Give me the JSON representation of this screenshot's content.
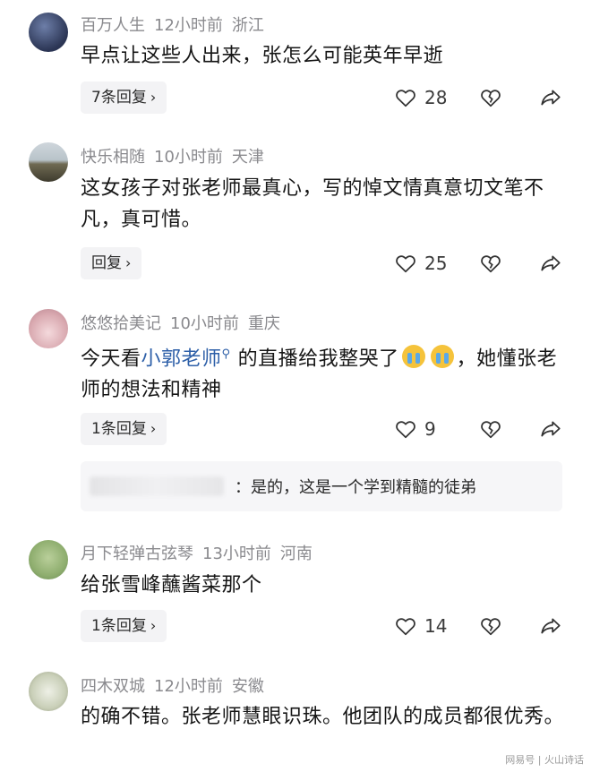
{
  "comments": [
    {
      "user": "百万人生",
      "time": "12小时前",
      "location": "浙江",
      "text": "早点让这些人出来，张怎么可能英年早逝",
      "reply_label": "7条回复",
      "likes": "28"
    },
    {
      "user": "快乐相随",
      "time": "10小时前",
      "location": "天津",
      "text": "这女孩子对张老师最真心，写的悼文情真意切文笔不凡，真可惜。",
      "reply_label": "回复",
      "likes": "25"
    },
    {
      "user": "悠悠拾美记",
      "time": "10小时前",
      "location": "重庆",
      "text_before": "今天看",
      "link_text": "小郭老师",
      "text_after": "的直播给我整哭了",
      "text_tail": "，她懂张老师的想法和精神",
      "reply_label": "1条回复",
      "likes": "9",
      "sub_reply": "：是的，这是一个学到精髓的徒弟"
    },
    {
      "user": "月下轻弹古弦琴",
      "time": "13小时前",
      "location": "河南",
      "text": "给张雪峰蘸酱菜那个",
      "reply_label": "1条回复",
      "likes": "14"
    },
    {
      "user": "四木双城",
      "time": "12小时前",
      "location": "安徽",
      "text": "的确不错。张老师慧眼识珠。他团队的成员都很优秀。"
    }
  ],
  "icons": {
    "like": "heart-outline-icon",
    "dislike": "broken-heart-icon",
    "share": "share-arrow-icon",
    "chevron": "chevron-right-icon"
  },
  "chevron_glyph": "›",
  "watermark": "网易号 | 火山诗话"
}
